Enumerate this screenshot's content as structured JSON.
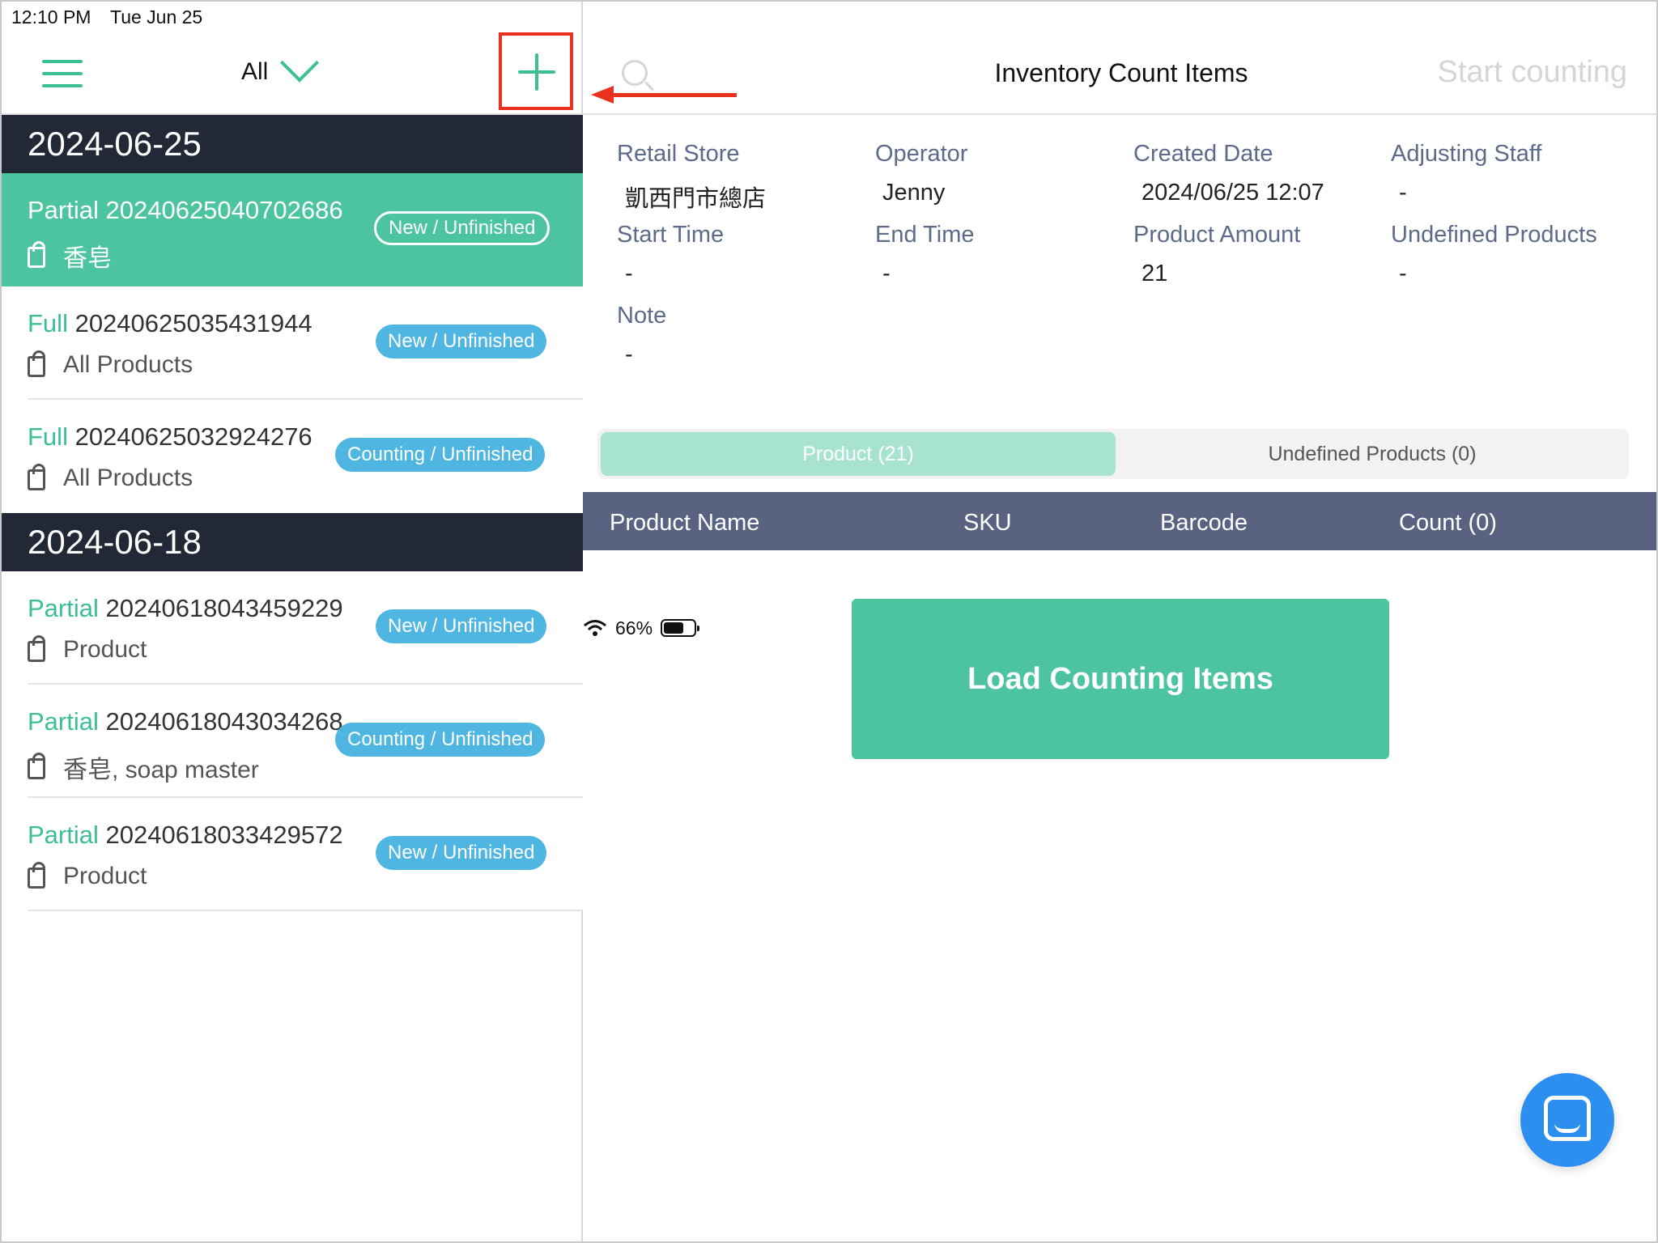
{
  "status_bar": {
    "time": "12:10 PM",
    "date": "Tue Jun 25",
    "battery": "66%",
    "battery_level": 0.66
  },
  "left_panel": {
    "filter_label": "All",
    "groups": [
      {
        "date": "2024-06-25",
        "items": [
          {
            "type": "Partial",
            "code": "20240625040702686",
            "products": "香皂",
            "status": "New / Unfinished",
            "selected": true
          },
          {
            "type": "Full",
            "code": "20240625035431944",
            "products": "All Products",
            "status": "New / Unfinished"
          },
          {
            "type": "Full",
            "code": "20240625032924276",
            "products": "All Products",
            "status": "Counting / Unfinished"
          }
        ]
      },
      {
        "date": "2024-06-18",
        "items": [
          {
            "type": "Partial",
            "code": "20240618043459229",
            "products": "Product",
            "status": "New / Unfinished"
          },
          {
            "type": "Partial",
            "code": "20240618043034268",
            "products": "香皂, soap master",
            "status": "Counting / Unfinished"
          },
          {
            "type": "Partial",
            "code": "20240618033429572",
            "products": "Product",
            "status": "New / Unfinished"
          }
        ]
      }
    ]
  },
  "right_panel": {
    "title": "Inventory Count Items",
    "start_label": "Start counting",
    "info": {
      "retail_store_label": "Retail Store",
      "retail_store_value": "凱西門市總店",
      "operator_label": "Operator",
      "operator_value": "Jenny",
      "created_date_label": "Created Date",
      "created_date_value": "2024/06/25 12:07",
      "adjusting_staff_label": "Adjusting Staff",
      "adjusting_staff_value": "-",
      "start_time_label": "Start Time",
      "start_time_value": "-",
      "end_time_label": "End Time",
      "end_time_value": "-",
      "product_amount_label": "Product Amount",
      "product_amount_value": "21",
      "undefined_products_label": "Undefined Products",
      "undefined_products_value": "-",
      "note_label": "Note",
      "note_value": "-"
    },
    "tabs": {
      "product": "Product (21)",
      "undefined": "Undefined Products (0)"
    },
    "table_headers": {
      "name": "Product Name",
      "sku": "SKU",
      "barcode": "Barcode",
      "count": "Count (0)"
    },
    "load_button": "Load Counting Items"
  },
  "colors": {
    "accent": "#4cc49f",
    "header_dark": "#232836",
    "table_head": "#596381",
    "badge": "#4fb6e2",
    "annotation": "#e8311e",
    "chat_fab": "#2c8ff0"
  }
}
